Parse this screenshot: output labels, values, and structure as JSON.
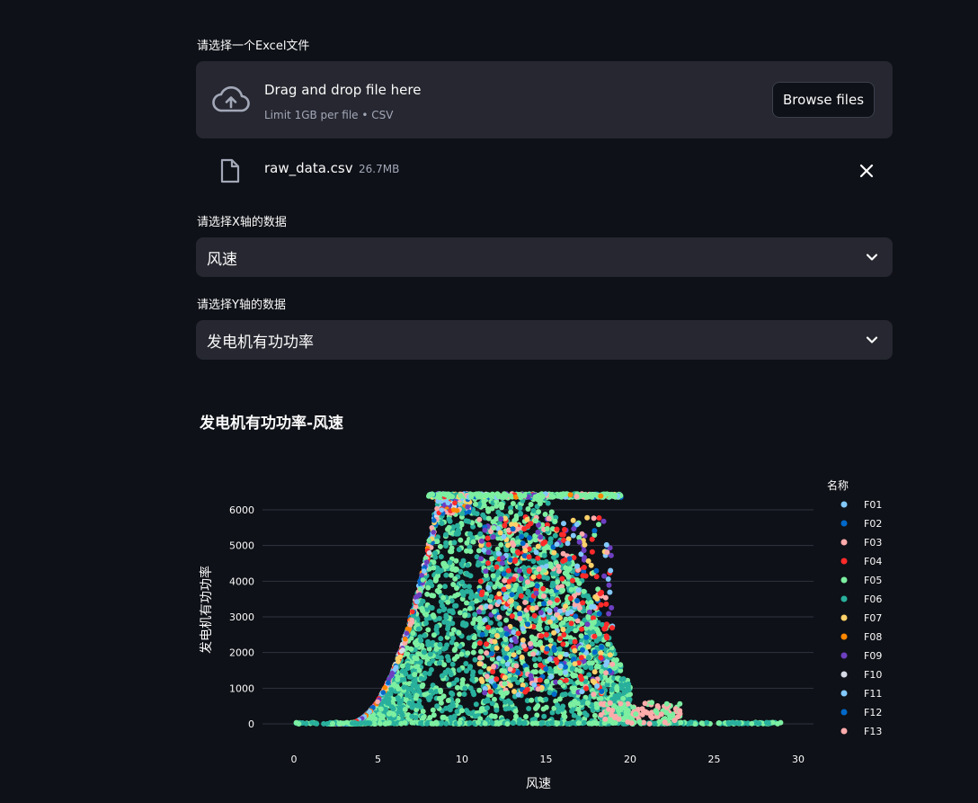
{
  "uploader": {
    "label": "请选择一个Excel文件",
    "drag_text": "Drag and drop file here",
    "limit_text": "Limit 1GB per file • CSV",
    "browse_label": "Browse files",
    "file": {
      "name": "raw_data.csv",
      "size": "26.7MB"
    }
  },
  "x_select": {
    "label": "请选择X轴的数据",
    "value": "风速"
  },
  "y_select": {
    "label": "请选择Y轴的数据",
    "value": "发电机有功功率"
  },
  "chart": {
    "title": "发电机有功功率-风速",
    "xlabel": "风速",
    "ylabel": "发电机有功功率",
    "legend_title": "名称"
  },
  "chart_data": {
    "type": "scatter",
    "title": "发电机有功功率-风速",
    "xlabel": "风速",
    "ylabel": "发电机有功功率",
    "xlim": [
      -2,
      30
    ],
    "ylim": [
      -300,
      6600
    ],
    "xticks": [
      0,
      5,
      10,
      15,
      20,
      25,
      30
    ],
    "yticks": [
      0,
      1000,
      2000,
      3000,
      4000,
      5000,
      6000
    ],
    "legend_title": "名称",
    "legend_position": "right",
    "grid": true,
    "series": [
      {
        "name": "F01",
        "color": "#83c9ff"
      },
      {
        "name": "F02",
        "color": "#0068c9"
      },
      {
        "name": "F03",
        "color": "#ffabab"
      },
      {
        "name": "F04",
        "color": "#ff2b2b"
      },
      {
        "name": "F05",
        "color": "#7defa1"
      },
      {
        "name": "F06",
        "color": "#29b09d"
      },
      {
        "name": "F07",
        "color": "#ffd16a"
      },
      {
        "name": "F08",
        "color": "#ff8700"
      },
      {
        "name": "F09",
        "color": "#6d3fc0"
      },
      {
        "name": "F10",
        "color": "#d5dae5"
      },
      {
        "name": "F11",
        "color": "#83c9ff"
      },
      {
        "name": "F12",
        "color": "#0068c9"
      },
      {
        "name": "F13",
        "color": "#ffabab"
      }
    ]
  }
}
